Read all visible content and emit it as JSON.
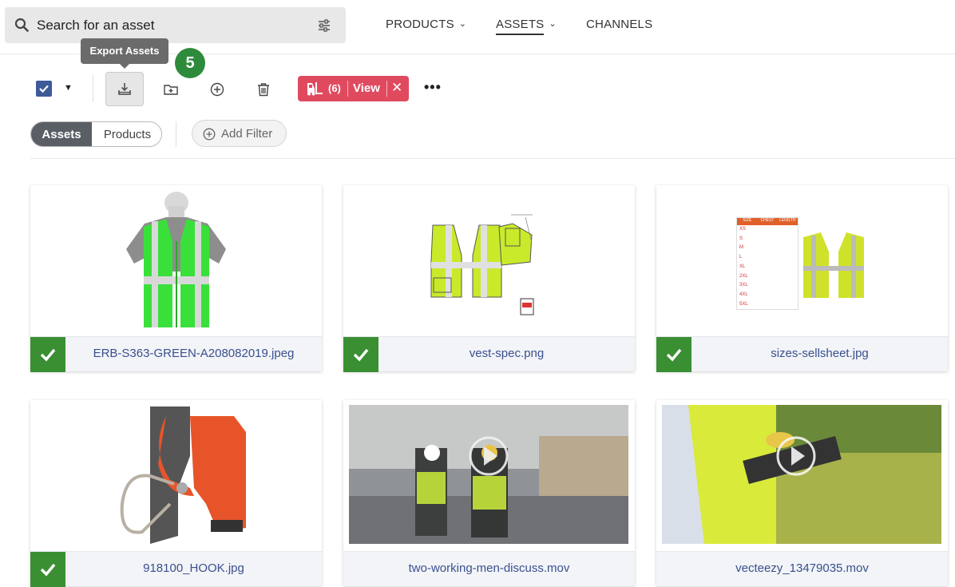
{
  "search": {
    "placeholder": "Search for an asset"
  },
  "nav": [
    {
      "label": "PRODUCTS",
      "has_chevron": true
    },
    {
      "label": "ASSETS",
      "has_chevron": true,
      "active": true
    },
    {
      "label": "CHANNELS",
      "has_chevron": false
    }
  ],
  "tooltip": {
    "text": "Export Assets"
  },
  "step_badge": "5",
  "toolbar": {
    "select_all_checked": true,
    "icons": [
      "export-icon",
      "add-to-folder-icon",
      "add-icon",
      "delete-icon"
    ],
    "selection_pill": {
      "count": "(6)",
      "label": "View",
      "close": "✕",
      "color": "#e04a5f"
    },
    "more": "•••"
  },
  "filters": {
    "toggle": {
      "active": "Assets",
      "inactive": "Products"
    },
    "add_filter": "Add Filter"
  },
  "assets": [
    {
      "filename": "ERB-S363-GREEN-A208082019.jpeg",
      "checked": true,
      "kind": "image"
    },
    {
      "filename": "vest-spec.png",
      "checked": true,
      "kind": "image"
    },
    {
      "filename": "sizes-sellsheet.jpg",
      "checked": true,
      "kind": "image"
    },
    {
      "filename": "918100_HOOK.jpg",
      "checked": true,
      "kind": "image"
    },
    {
      "filename": "two-working-men-discuss.mov",
      "checked": false,
      "kind": "video"
    },
    {
      "filename": "vecteezy_13479035.mov",
      "checked": false,
      "kind": "video"
    }
  ],
  "sizes_sheet": {
    "header": [
      "SIZE",
      "CHEST",
      "LENGTH"
    ],
    "rows": [
      "XS",
      "S",
      "M",
      "L",
      "XL",
      "2XL",
      "3XL",
      "4XL",
      "5XL"
    ]
  },
  "colors": {
    "accent_check": "#3a8f33",
    "filename_link": "#3a4f8f",
    "checkbox": "#3d5a99"
  }
}
